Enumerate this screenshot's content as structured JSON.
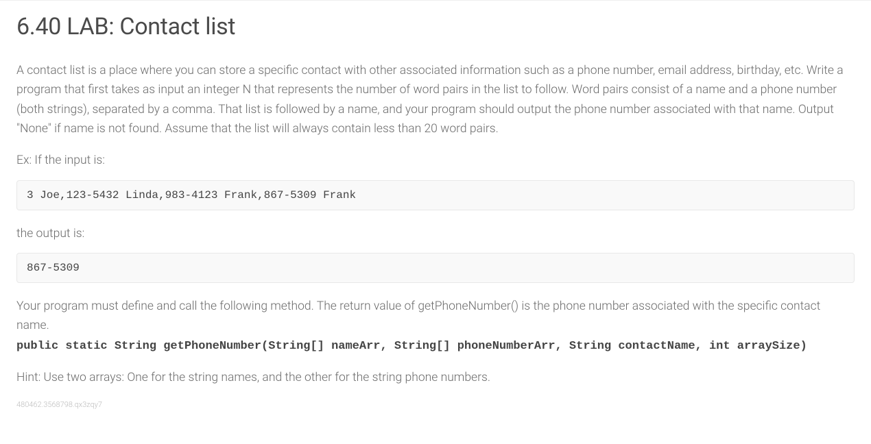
{
  "title": "6.40 LAB: Contact list",
  "description": "A contact list is a place where you can store a specific contact with other associated information such as a phone number, email address, birthday, etc. Write a program that first takes as input an integer N that represents the number of word pairs in the list to follow. Word pairs consist of a name and a phone number (both strings), separated by a comma. That list is followed by a name, and your program should output the phone number associated with that name. Output \"None\" if name is not found. Assume that the list will always contain less than 20 word pairs.",
  "example_input_label": "Ex: If the input is:",
  "example_input": "3 Joe,123-5432 Linda,983-4123 Frank,867-5309 Frank",
  "example_output_label": "the output is:",
  "example_output": "867-5309",
  "method_intro": "Your program must define and call the following method. The return value of getPhoneNumber() is the phone number associated with the specific contact name.",
  "method_signature": "public static String getPhoneNumber(String[] nameArr, String[] phoneNumberArr, String contactName, int arraySize)",
  "hint": "Hint: Use two arrays: One for the string names, and the other for the string phone numbers.",
  "footer_id": "480462.3568798.qx3zqy7"
}
